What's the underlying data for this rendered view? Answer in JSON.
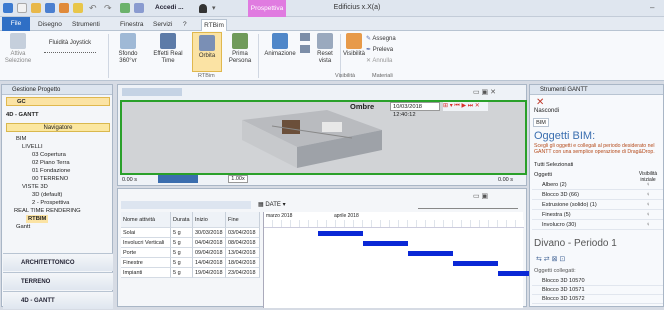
{
  "window": {
    "title": "Edificius x.X(a)",
    "accedi": "Accedi ...",
    "contextual_tab": "Prospettiva"
  },
  "tabs": [
    "File",
    "Disegno",
    "Strumenti",
    "Finestra",
    "Servizi",
    "?",
    "RTBim"
  ],
  "ribbon": {
    "attiva_selezione": "Attiva Selezione",
    "fluidita": "Fluidità Joystick",
    "sfondo": "Sfondo 360°vr",
    "effetti": "Effetti Real Time",
    "orbita": "Orbita",
    "prima_persona": "Prima Persona",
    "animazione": "Animazione",
    "reset_vista": "Reset vista",
    "visibilita": "Visibilità",
    "assegna": "Assegna",
    "preleva": "Preleva",
    "annulla": "Annulla",
    "group_rtbim": "RTBim",
    "group_visibilita": "Visibilità",
    "group_materiali": "Materiali"
  },
  "left_panel": {
    "title": "Gestione Progetto",
    "gc": "GC",
    "section": "4D - GANTT",
    "navigator": "Navigatore",
    "tree": [
      "BIM",
      "LIVELLI",
      "03 Copertura",
      "02 Piano Terra",
      "01 Fondazione",
      "00 TERRENO",
      "VISTE 3D",
      "3D (default)",
      "2 - Prospettiva",
      "REAL TIME RENDERING",
      "RTBIM",
      "Gantt"
    ],
    "categories": [
      "ARCHITETTONICO",
      "TERRENO",
      "4D - GANTT"
    ]
  },
  "viewport": {
    "ombre": "Ombre",
    "date": "10/03/2018 12:40:12",
    "speed": "0.00 s",
    "zoom": "1.00x",
    "time_end": "0.00 s"
  },
  "gantt": {
    "date_menu": "DATE",
    "columns": [
      "Nome attività",
      "Durata",
      "Inizio",
      "Fine"
    ],
    "months": [
      "marzo 2018",
      "aprile 2018"
    ],
    "rows": [
      {
        "name": "Solai",
        "dur": "5 g",
        "start": "30/03/2018",
        "end": "03/04/2018"
      },
      {
        "name": "Involucri Verticali",
        "dur": "5 g",
        "start": "04/04/2018",
        "end": "08/04/2018"
      },
      {
        "name": "Porte",
        "dur": "5 g",
        "start": "09/04/2018",
        "end": "13/04/2018"
      },
      {
        "name": "Finestre",
        "dur": "5 g",
        "start": "14/04/2018",
        "end": "18/04/2018"
      },
      {
        "name": "Impianti",
        "dur": "5 g",
        "start": "19/04/2018",
        "end": "23/04/2018"
      }
    ],
    "bar_color": "#0a28d6"
  },
  "right_panel": {
    "title": "Strumenti GANTT",
    "nascondi": "Nascondi",
    "tab": "BIM",
    "heading": "Oggetti BIM:",
    "desc": "Scegli gli oggetti e collegali al periodo desiderato nel GANTT con una semplice operazione di Drag&Drop.",
    "filter_tabs": [
      "Tutti",
      "Selezionati"
    ],
    "col_objects": "Oggetti",
    "col_vis": "Visibilità iniziale",
    "objects": [
      "Albero (2)",
      "Blocco 3D (66)",
      "Estrusione (solido) (1)",
      "Finestra (5)",
      "Involucro (30)"
    ],
    "period": "Divano - Periodo 1",
    "linked_label": "Oggetti collegati:",
    "linked": [
      "Blocco 3D 10570",
      "Blocco 3D 10571",
      "Blocco 3D 10572"
    ]
  }
}
